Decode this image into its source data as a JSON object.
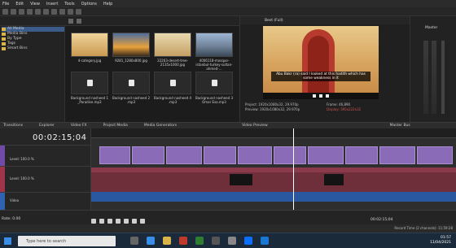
{
  "menu": [
    "File",
    "Edit",
    "View",
    "Insert",
    "Tools",
    "Options",
    "Help"
  ],
  "explorer": {
    "items": [
      "All Media",
      "Media Bins",
      "By Type",
      "Tags",
      "Smart Bins"
    ]
  },
  "media": {
    "items": [
      {
        "label": "4-category.jpg",
        "kind": "image"
      },
      {
        "label": "9281_1280x800.jpg",
        "kind": "image"
      },
      {
        "label": "22263-desert-tree-2135x1000.jpg",
        "kind": "image"
      },
      {
        "label": "4006118-mosque-istanbul-turkey-sultan-ahmed-...",
        "kind": "image"
      },
      {
        "label": "Background nasheed 1 _Paradise.mp3",
        "kind": "audio"
      },
      {
        "label": "Background nasheed 2 .mp3",
        "kind": "audio"
      },
      {
        "label": "Background nasheed 4 .mp3",
        "kind": "audio"
      },
      {
        "label": "Background nasheed 3 Omar Esa.mp3",
        "kind": "audio"
      }
    ]
  },
  "preview": {
    "quality": "Best (Full)",
    "subtitle": "Abu Bakr (ra) said I looked at this hadith which has some weakness in it",
    "project": "1920x1080x32, 29.970p",
    "preview_res": "1920x1080x32, 29.970p",
    "display": "Video Preview",
    "frame": "46,890",
    "display_val": "395x222x32"
  },
  "master": {
    "label": "Master",
    "bus": "Master Bus"
  },
  "tabs": [
    "Transitions",
    "Explorer",
    "Video FX",
    "Project Media",
    "Media Generators",
    "Video Preview"
  ],
  "timeline": {
    "timecode": "00:02:15;04",
    "tracks": [
      {
        "label": "Level: 100.0 %"
      },
      {
        "label": "Level: 100.0 %"
      },
      {
        "label": "Video"
      }
    ],
    "rate": "Rate: 0.00"
  },
  "status": {
    "record": "Record Time (2 channels): 11:59:28",
    "position": "00:02:15;04"
  },
  "taskbar": {
    "search_placeholder": "Type here to search",
    "time": "01:57",
    "date": "11/04/2021"
  }
}
